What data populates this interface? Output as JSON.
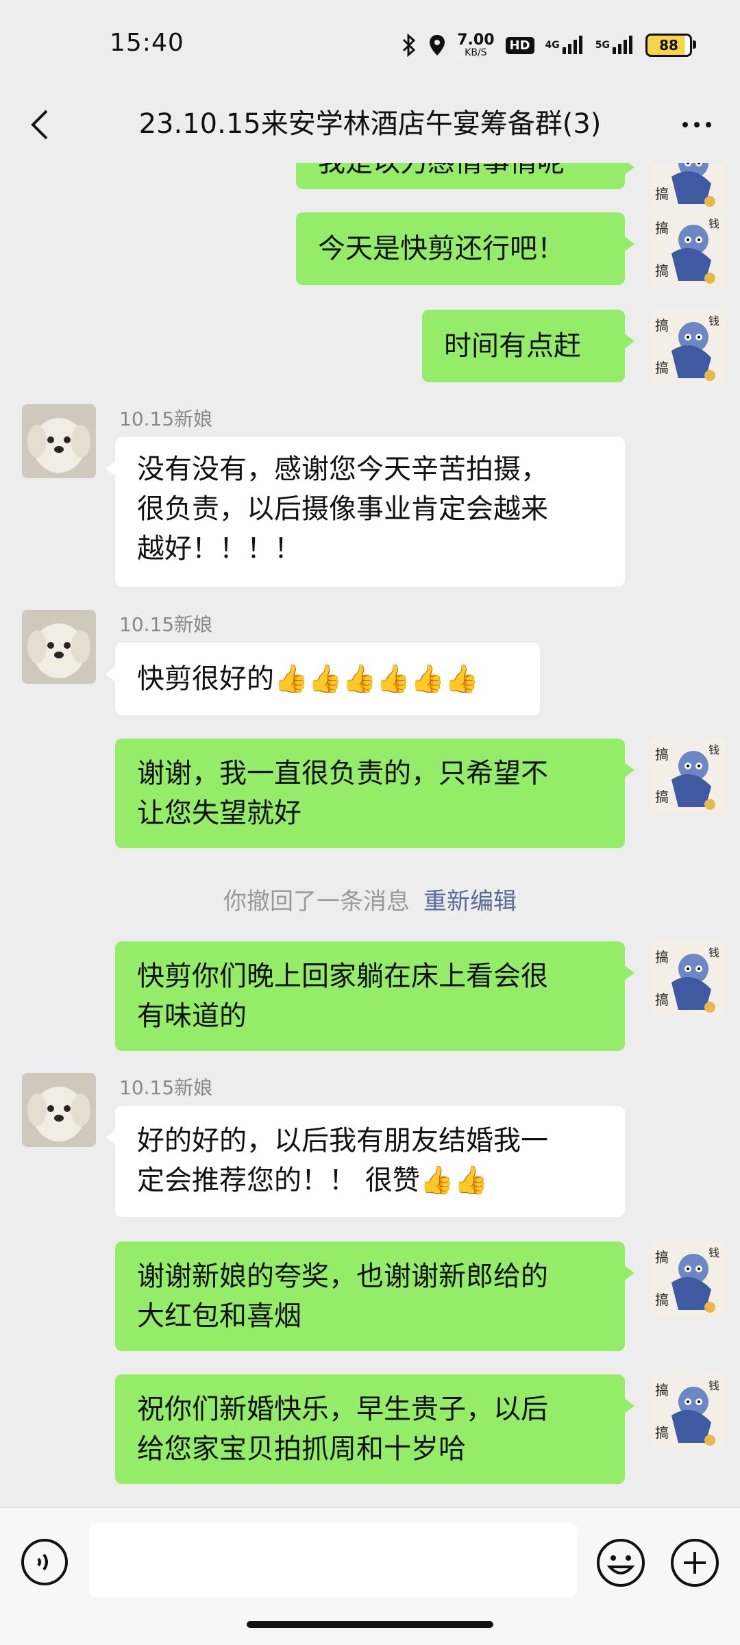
{
  "status": {
    "time": "15:40",
    "speed": "7.00",
    "speed_unit": "KB/S",
    "hd": "HD",
    "net1": "4G",
    "net2": "5G",
    "battery": "88"
  },
  "header": {
    "title": "23.10.15来安学林酒店午宴筹备群(3)"
  },
  "messages": [
    {
      "from": "me",
      "text": "我是以力感情事情呢"
    },
    {
      "from": "me",
      "text": "今天是快剪还行吧！"
    },
    {
      "from": "me",
      "text": "时间有点赶"
    },
    {
      "from": "other",
      "sender": "10.15新娘",
      "lines": [
        "没有没有，感谢您今天辛苦拍摄，",
        "很负责，以后摄像事业肯定会越来",
        "越好！！！！"
      ]
    },
    {
      "from": "other",
      "sender": "10.15新娘",
      "text": "快剪很好的",
      "thumbs": "👍👍👍👍👍👍"
    },
    {
      "from": "me",
      "lines": [
        "谢谢，我一直很负责的，只希望不",
        "让您失望就好"
      ]
    },
    {
      "from": "system",
      "text": "你撤回了一条消息",
      "link": "重新编辑"
    },
    {
      "from": "me",
      "lines": [
        "快剪你们晚上回家躺在床上看会很",
        "有味道的"
      ]
    },
    {
      "from": "other",
      "sender": "10.15新娘",
      "lines": [
        "好的好的，以后我有朋友结婚我一",
        "定会推荐您的！！ 很赞"
      ],
      "thumbs": "👍👍"
    },
    {
      "from": "me",
      "lines": [
        "谢谢新娘的夸奖，也谢谢新郎给的",
        "大红包和喜烟"
      ]
    },
    {
      "from": "me",
      "lines": [
        "祝你们新婚快乐，早生贵子，以后",
        "给您家宝贝拍抓周和十岁哈"
      ]
    }
  ]
}
